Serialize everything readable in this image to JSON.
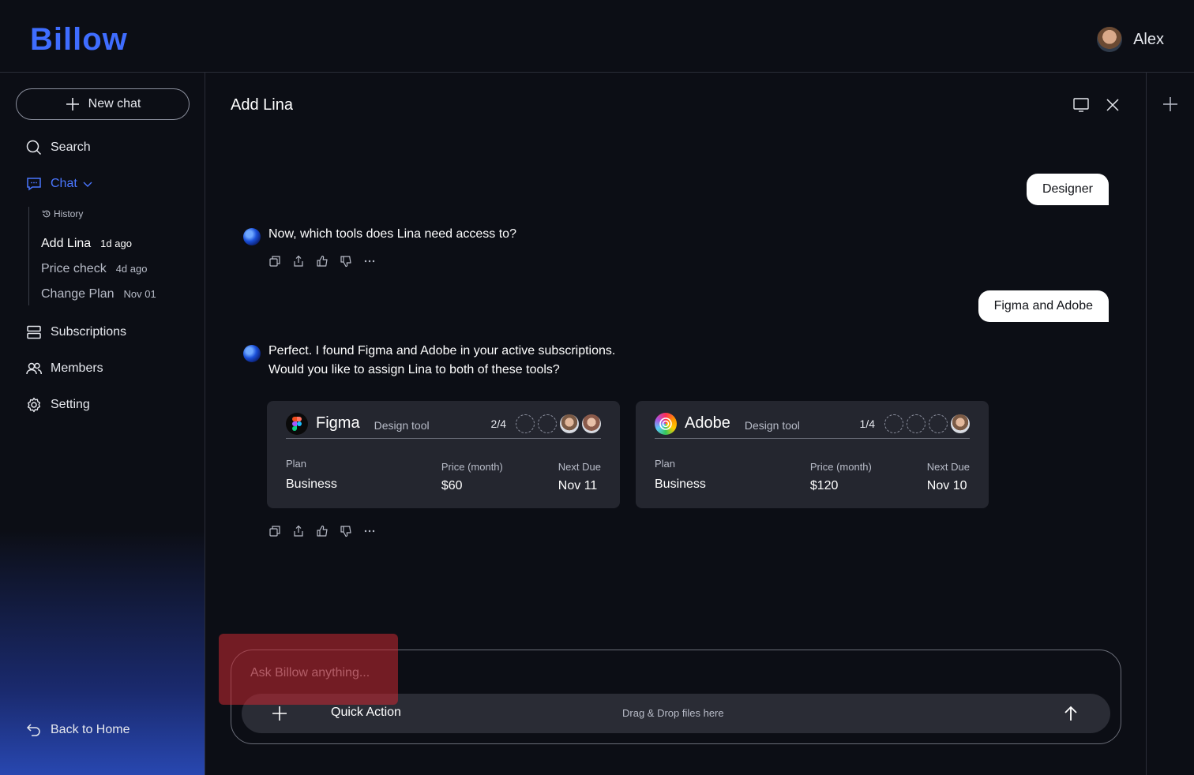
{
  "app": {
    "logo": "Billow"
  },
  "user": {
    "name": "Alex"
  },
  "sidebar": {
    "new_chat": "New chat",
    "search": "Search",
    "chat": "Chat",
    "history_label": "History",
    "history": [
      {
        "title": "Add Lina",
        "time": "1d ago"
      },
      {
        "title": "Price check",
        "time": "4d ago"
      },
      {
        "title": "Change Plan",
        "time": "Nov 01"
      }
    ],
    "subscriptions": "Subscriptions",
    "members": "Members",
    "setting": "Setting",
    "back_home": "Back to Home"
  },
  "chat": {
    "title": "Add Lina",
    "user_msg_1": "Designer",
    "bot_msg_1": "Now, which tools does Lina need access to?",
    "user_msg_2": "Figma and Adobe",
    "bot_msg_2_line1": "Perfect. I found Figma and Adobe in your active subscriptions.",
    "bot_msg_2_line2": "Would you like to assign Lina to both of these tools?"
  },
  "cards": [
    {
      "name": "Figma",
      "type": "Design tool",
      "seats": "2/4",
      "plan_label": "Plan",
      "plan": "Business",
      "price_label": "Price (month)",
      "price": "$60",
      "due_label": "Next Due",
      "due": "Nov 11"
    },
    {
      "name": "Adobe",
      "type": "Design tool",
      "seats": "1/4",
      "plan_label": "Plan",
      "plan": "Business",
      "price_label": "Price (month)",
      "price": "$120",
      "due_label": "Next Due",
      "due": "Nov 10"
    }
  ],
  "composer": {
    "placeholder": "Ask Billow anything...",
    "quick_action": "Quick Action",
    "drop_hint": "Drag & Drop files here"
  },
  "colors": {
    "accent": "#3f6dff",
    "background": "#0c0e15",
    "card": "#24262f"
  }
}
